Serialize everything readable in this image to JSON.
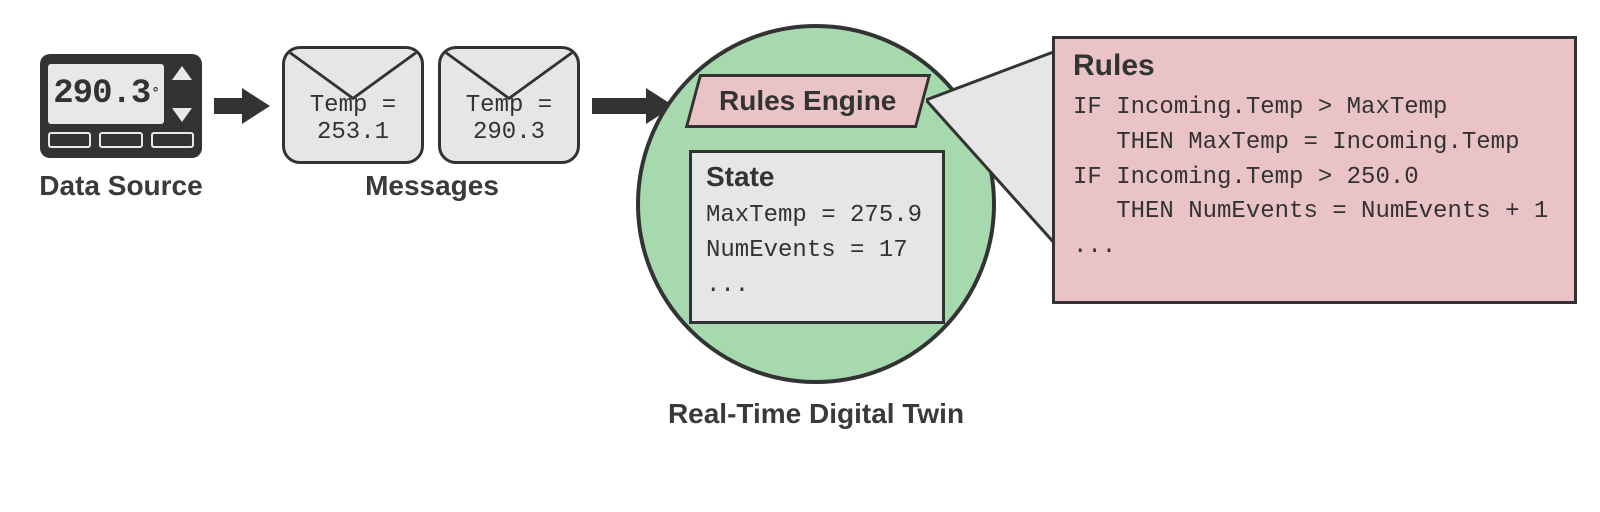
{
  "dataSource": {
    "caption": "Data Source",
    "display": "290.3",
    "degree": "°"
  },
  "messages": {
    "caption": "Messages",
    "msg1": {
      "label": "Temp =",
      "value": "253.1"
    },
    "msg2": {
      "label": "Temp =",
      "value": "290.3"
    }
  },
  "twin": {
    "caption": "Real-Time Digital Twin",
    "rulesEngineLabel": "Rules Engine",
    "state": {
      "title": "State",
      "line1": "MaxTemp = 275.9",
      "line2": "NumEvents = 17",
      "ellipsis": "..."
    }
  },
  "rules": {
    "title": "Rules",
    "line1": "IF Incoming.Temp > MaxTemp",
    "line2": "   THEN MaxTemp = Incoming.Temp",
    "line3": "IF Incoming.Temp > 250.0",
    "line4": "   THEN NumEvents = NumEvents + 1",
    "ellipsis": "..."
  }
}
